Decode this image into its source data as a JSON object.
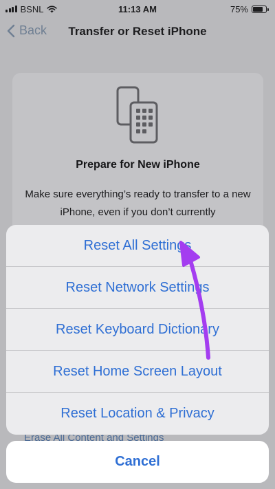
{
  "status_bar": {
    "carrier": "BSNL",
    "time": "11:13 AM",
    "battery": "75%",
    "battery_level": 0.75,
    "icons": [
      "signal-icon",
      "wifi-icon",
      "battery-icon"
    ]
  },
  "nav": {
    "back_label": "Back",
    "title": "Transfer or Reset iPhone"
  },
  "prepare_card": {
    "icon": "phones-transfer-icon",
    "title": "Prepare for New iPhone",
    "text": "Make sure everything’s ready to transfer to a new iPhone, even if you don’t currently"
  },
  "background_link": "Erase All Content and Settings",
  "action_sheet": {
    "items": [
      "Reset All Settings",
      "Reset Network Settings",
      "Reset Keyboard Dictionary",
      "Reset Home Screen Layout",
      "Reset Location & Privacy"
    ],
    "cancel_label": "Cancel"
  },
  "colors": {
    "accent": "#2f6fd4",
    "annotation_arrow": "#a43df0"
  }
}
